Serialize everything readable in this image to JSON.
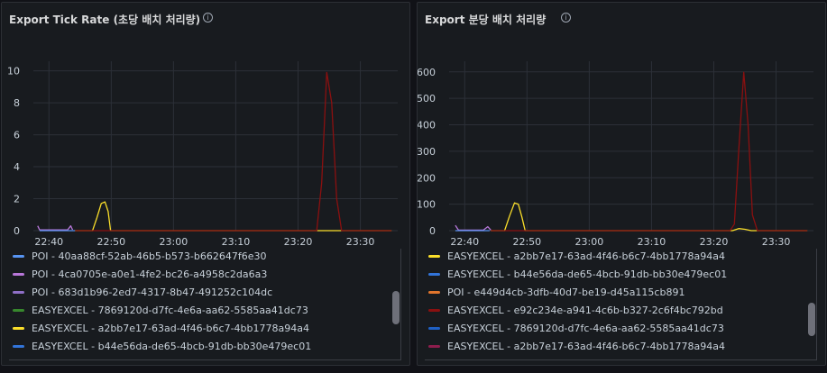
{
  "colors": {
    "background": "#111217",
    "panel": "#181b1f",
    "grid": "#2c3038"
  },
  "panels": [
    {
      "title": "Export Tick Rate (초당 배치 처리량)",
      "legend": [
        {
          "label": "POI - 40aa88cf-52ab-46b5-b573-b662647f6e30",
          "color": "#5794f2"
        },
        {
          "label": "POI - 4ca0705e-a0e1-4fe2-bc26-a4958c2da6a3",
          "color": "#b877d9"
        },
        {
          "label": "POI - 683d1b96-2ed7-4317-8b47-491252c104dc",
          "color": "#8f6fc7"
        },
        {
          "label": "EASYEXCEL - 7869120d-d7fc-4e6a-aa62-5585aa41dc73",
          "color": "#37872d"
        },
        {
          "label": "EASYEXCEL - a2bb7e17-63ad-4f46-b6c7-4bb1778a94a4",
          "color": "#fade2a"
        },
        {
          "label": "EASYEXCEL - b44e56da-de65-4bcb-91db-bb30e479ec01",
          "color": "#3274d9"
        }
      ]
    },
    {
      "title": "Export 분당 배치 처리량",
      "legend": [
        {
          "label": "EASYEXCEL - a2bb7e17-63ad-4f46-b6c7-4bb1778a94a4",
          "color": "#fade2a"
        },
        {
          "label": "EASYEXCEL - b44e56da-de65-4bcb-91db-bb30e479ec01",
          "color": "#3274d9"
        },
        {
          "label": "POI - e449d4cb-3dfb-40d7-be19-d45a115cb891",
          "color": "#e0752d"
        },
        {
          "label": "EASYEXCEL - e92c234e-a941-4c6b-b327-2c6f4bc792bd",
          "color": "#8a1010"
        },
        {
          "label": "EASYEXCEL - 7869120d-d7fc-4e6a-aa62-5585aa41dc73",
          "color": "#1f60c4"
        },
        {
          "label": "EASYEXCEL - a2bb7e17-63ad-4f46-b6c7-4bb1778a94a4",
          "color": "#8e1d4d"
        }
      ]
    }
  ],
  "chart_data": [
    {
      "type": "line",
      "title": "Export Tick Rate (초당 배치 처리량)",
      "x_ticks": [
        "22:40",
        "22:50",
        "23:00",
        "23:10",
        "23:20",
        "23:30"
      ],
      "y_ticks": [
        "0",
        "2",
        "4",
        "6",
        "8",
        "10"
      ],
      "xlim_minutes": [
        -22.5,
        36
      ],
      "ylim": [
        0,
        10.6
      ],
      "grid": true,
      "series": [
        {
          "color": "#b877d9",
          "points": [
            [
              -21.8,
              0.3
            ],
            [
              -21.5,
              0.05
            ],
            [
              -20,
              0.05
            ],
            [
              -17,
              0.05
            ],
            [
              -16.5,
              0.3
            ],
            [
              -16.2,
              0.05
            ]
          ]
        },
        {
          "color": "#5794f2",
          "points": [
            [
              -21.5,
              0
            ],
            [
              -16,
              0
            ],
            [
              -15.8,
              0
            ]
          ]
        },
        {
          "color": "#fade2a",
          "points": [
            [
              -15.8,
              0
            ],
            [
              -13,
              0
            ],
            [
              -12.3,
              0.8
            ],
            [
              -11.6,
              1.7
            ],
            [
              -11,
              1.8
            ],
            [
              -10.5,
              1.2
            ],
            [
              -10.1,
              0
            ],
            [
              -5,
              0
            ],
            [
              35,
              0
            ]
          ]
        },
        {
          "color": "#8a1010",
          "points": [
            [
              -15.8,
              0
            ],
            [
              23,
              0
            ],
            [
              23.8,
              3
            ],
            [
              24.6,
              9.9
            ],
            [
              25.4,
              8
            ],
            [
              26.2,
              2
            ],
            [
              27,
              0
            ],
            [
              35,
              0
            ]
          ]
        }
      ]
    },
    {
      "type": "line",
      "title": "Export 분당 배치 처리량",
      "x_ticks": [
        "22:40",
        "22:50",
        "23:00",
        "23:10",
        "23:20",
        "23:30"
      ],
      "y_ticks": [
        "0",
        "100",
        "200",
        "300",
        "400",
        "500",
        "600"
      ],
      "xlim_minutes": [
        -22.5,
        36
      ],
      "ylim": [
        0,
        640
      ],
      "grid": true,
      "series": [
        {
          "color": "#b877d9",
          "points": [
            [
              -21.5,
              20
            ],
            [
              -21,
              2
            ],
            [
              -19,
              2
            ],
            [
              -17,
              2
            ],
            [
              -16.3,
              15
            ],
            [
              -15.8,
              2
            ]
          ]
        },
        {
          "color": "#5794f2",
          "points": [
            [
              -21.5,
              0
            ],
            [
              -16,
              0
            ]
          ]
        },
        {
          "color": "#fade2a",
          "points": [
            [
              -15.8,
              0
            ],
            [
              -13.6,
              0
            ],
            [
              -12.8,
              55
            ],
            [
              -12,
              105
            ],
            [
              -11.4,
              100
            ],
            [
              -10.8,
              50
            ],
            [
              -10.3,
              0
            ],
            [
              23,
              0
            ],
            [
              24,
              8
            ],
            [
              25,
              5
            ],
            [
              26,
              0
            ],
            [
              35,
              0
            ]
          ]
        },
        {
          "color": "#8a1010",
          "points": [
            [
              -15.8,
              0
            ],
            [
              22.6,
              0
            ],
            [
              23.3,
              25
            ],
            [
              24,
              300
            ],
            [
              24.8,
              598
            ],
            [
              25.5,
              400
            ],
            [
              26.2,
              60
            ],
            [
              27,
              0
            ],
            [
              35,
              0
            ]
          ]
        }
      ]
    }
  ]
}
